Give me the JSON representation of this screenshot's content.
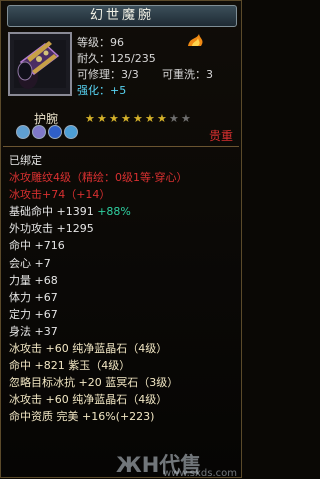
{
  "title": "幻世魔腕",
  "stats": {
    "level": "等级：96",
    "durability": "耐久：125/235",
    "repairable": "可修理：3/3",
    "rewashable": "可重洗：3",
    "enhance": "强化：+5"
  },
  "slot_label": "护腕",
  "stars": {
    "filled": 7,
    "total": 9
  },
  "rarity_label": "贵重",
  "lines": [
    {
      "text": "已绑定",
      "color": "#e6e6e6"
    },
    {
      "text": "冰攻雕纹4级（精绘：0级1等·穿心）",
      "color": "#d83030"
    },
    {
      "text": "冰攻击+74（+14）",
      "color": "#d83030"
    },
    {
      "text": "基础命中 +1391 +88%",
      "color": "#e6e6e6",
      "accent": "+88%",
      "accent_color": "#2fd0a0"
    },
    {
      "text": "外功攻击 +1295",
      "color": "#e6e6e6"
    },
    {
      "text": "命中 +716",
      "color": "#e6e6e6"
    },
    {
      "text": "会心 +7",
      "color": "#e6e6e6"
    },
    {
      "text": "力量 +68",
      "color": "#e6e6e6"
    },
    {
      "text": "体力 +67",
      "color": "#e6e6e6"
    },
    {
      "text": "定力 +67",
      "color": "#e6e6e6"
    },
    {
      "text": "身法 +37",
      "color": "#e6e6e6"
    },
    {
      "text": "冰攻击 +60 纯净蓝晶石（4级）",
      "color": "#f2e7c4"
    },
    {
      "text": "命中 +821 紫玉（4级）",
      "color": "#f2e7c4"
    },
    {
      "text": "忽略目标冰抗 +20 蓝冥石（3级）",
      "color": "#f2e7c4"
    },
    {
      "text": "冰攻击 +60 纯净蓝晶石（4级）",
      "color": "#f2e7c4"
    },
    {
      "text": "命中资质   完美 +16%(+223)",
      "color": "#f2e7c4"
    }
  ],
  "watermark": "ЖН代售",
  "watermark_url": "www.sxds.com",
  "colors": {
    "title_bg": "#2d3c46",
    "star": "#d4b12a",
    "rarity": "#d83030"
  }
}
